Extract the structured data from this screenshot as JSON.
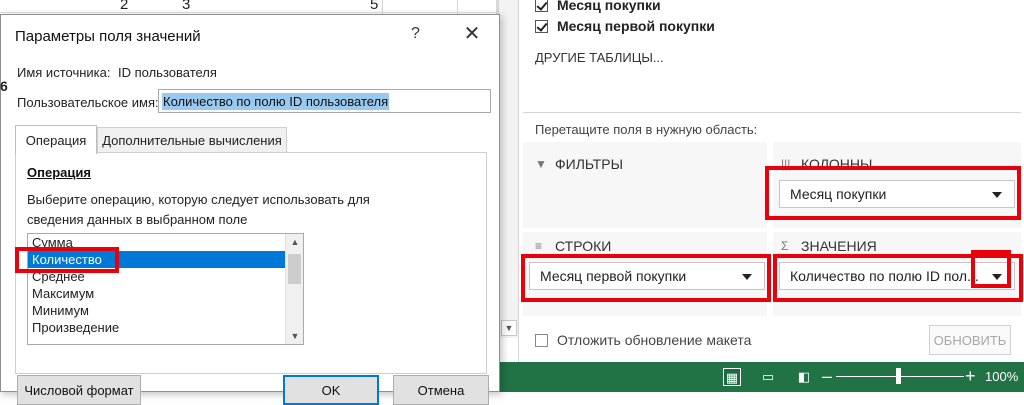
{
  "sheet": {
    "visible_numbers": [
      "2",
      "3",
      "5"
    ],
    "row_header_fragment": "6"
  },
  "dialog": {
    "title": "Параметры поля значений",
    "help_glyph": "?",
    "close_glyph": "✕",
    "source_name_label": "Имя источника:",
    "source_name_value": "ID пользователя",
    "custom_name_label": "Пользовательское имя:",
    "custom_name_value": "Количество по полю ID пользователя",
    "tabs": [
      {
        "label": "Операция",
        "active": true
      },
      {
        "label": "Дополнительные вычисления",
        "active": false
      }
    ],
    "section_title": "Операция",
    "description": "Выберите операцию, которую следует использовать для сведения данных в выбранном поле",
    "operations": [
      "Сумма",
      "Количество",
      "Среднее",
      "Максимум",
      "Минимум",
      "Произведение"
    ],
    "selected_operation": "Количество",
    "buttons": {
      "number_format": "Числовой формат",
      "ok": "OK",
      "cancel": "Отмена"
    }
  },
  "pivot_panel": {
    "fields": [
      {
        "label": "Месяц покупки",
        "checked": true
      },
      {
        "label": "Месяц первой покупки",
        "checked": true
      }
    ],
    "other_tables": "ДРУГИЕ ТАБЛИЦЫ...",
    "drag_hint": "Перетащите поля в нужную область:",
    "areas": {
      "filters": {
        "title": "ФИЛЬТРЫ",
        "icon": "filter-icon"
      },
      "columns": {
        "title": "КОЛОННЫ",
        "icon": "columns-icon",
        "item": "Месяц покупки"
      },
      "rows": {
        "title": "СТРОКИ",
        "icon": "rows-icon",
        "item": "Месяц первой покупки"
      },
      "values": {
        "title": "ЗНАЧЕНИЯ",
        "icon": "sigma-icon",
        "item": "Количество по полю ID пол..."
      }
    },
    "defer_update_label": "Отложить обновление макета",
    "update_button": "ОБНОВИТЬ"
  },
  "status_bar": {
    "zoom_minus": "–",
    "zoom_plus": "+",
    "zoom_level": "100%",
    "zoom_fraction": 0.5,
    "accent_color": "#217346"
  },
  "colors": {
    "highlight_red": "#e8000b",
    "selection_blue": "#0078d7",
    "text_selection": "#99c9ef"
  }
}
